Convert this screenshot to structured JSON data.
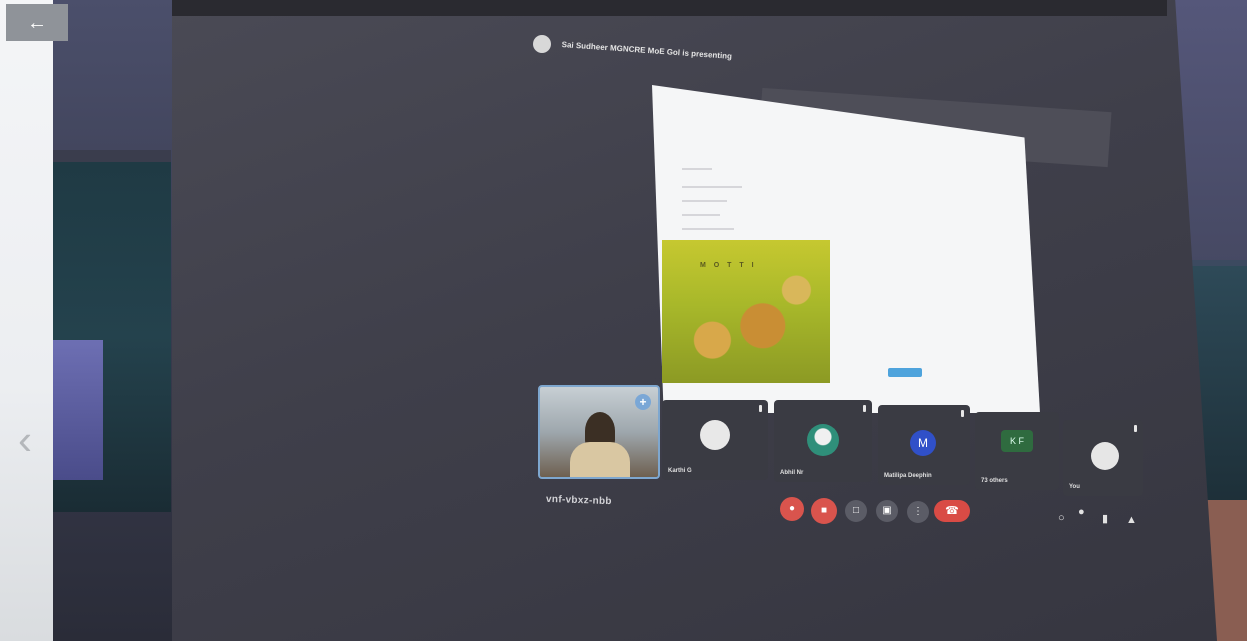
{
  "viewer": {
    "back_icon": "arrow-left-icon",
    "back_glyph": "←",
    "prev_icon": "chevron-left-icon",
    "prev_glyph": "‹"
  },
  "meet": {
    "presenting_text": "Sai Sudheer MGNCRE MoE Gol is presenting",
    "meeting_code": "vnf-vbxz-nbb",
    "slide": {
      "logo_text": "M O T T I"
    },
    "participants": [
      {
        "name": "",
        "self_view": true
      },
      {
        "name": "Karthi G"
      },
      {
        "name": "Abhil Nr"
      },
      {
        "name": "Matilipa Deephin",
        "avatar_letter": "M"
      },
      {
        "name": "73 others",
        "avatar_letters": "K F"
      },
      {
        "name": "You"
      }
    ],
    "controls": {
      "mic_icon": "mic-off-icon",
      "camera_icon": "camera-off-icon",
      "captions_icon": "captions-icon",
      "present_icon": "present-screen-icon",
      "more_icon": "more-options-icon",
      "hangup_icon": "hangup-icon",
      "info_icon": "info-icon",
      "people_icon": "people-icon",
      "chat_icon": "chat-icon",
      "activities_icon": "activities-icon"
    }
  },
  "colors": {
    "accent_red": "#d9544d",
    "tile_bg": "#3a3b43",
    "self_border": "#7ea7cf"
  }
}
